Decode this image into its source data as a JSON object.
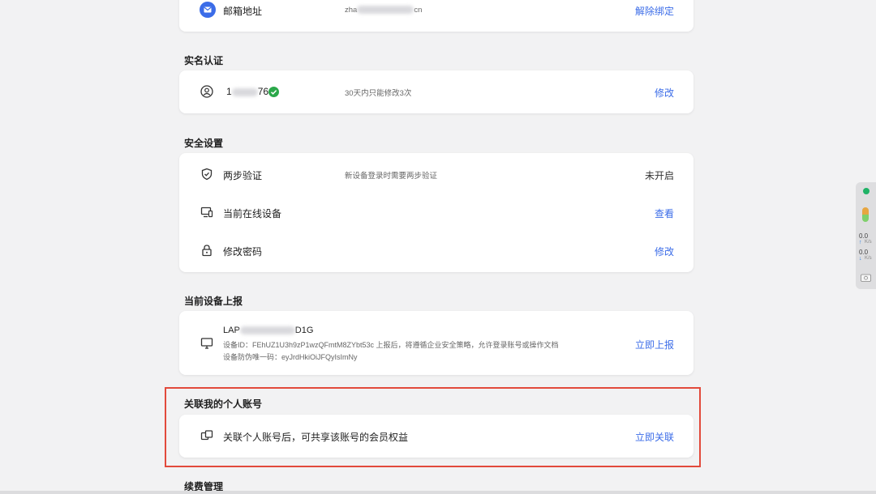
{
  "email": {
    "label": "邮箱地址",
    "value_start": "zha",
    "value_end": "cn",
    "action": "解除绑定"
  },
  "realname": {
    "title": "实名认证",
    "id_start": "1",
    "id_end": "76",
    "note": "30天内只能修改3次",
    "action": "修改"
  },
  "security": {
    "title": "安全设置",
    "rows": [
      {
        "label": "两步验证",
        "desc": "新设备登录时需要两步验证",
        "status": "未开启"
      },
      {
        "label": "当前在线设备",
        "action": "查看"
      },
      {
        "label": "修改密码",
        "action": "修改"
      }
    ]
  },
  "device_report": {
    "title": "当前设备上报",
    "name_start": "LAP",
    "name_end": "D1G",
    "device_id_line": "设备ID：FEhUZ1U3h9zP1wzQFmtM8ZYbt53c 上报后，将遵循企业安全策略，允许登录账号或操作文档",
    "anti_fake_line": "设备防伪唯一码：eyJrdHkiOiJFQyIsImNy",
    "action": "立即上报"
  },
  "personal": {
    "title": "关联我的个人账号",
    "desc": "关联个人账号后，可共享该账号的会员权益",
    "action": "立即关联"
  },
  "renewal": {
    "title": "续费管理"
  },
  "side_widget": {
    "up_value": "0.0",
    "up_unit": "K/s",
    "down_value": "0.0",
    "down_unit": "K/s"
  },
  "colors": {
    "accent": "#3b6ce8",
    "verified": "#2ba84a",
    "highlight": "#e24a3b"
  }
}
